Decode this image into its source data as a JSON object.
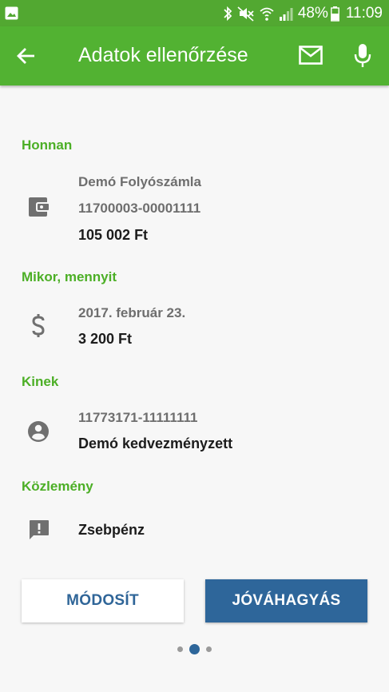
{
  "status_bar": {
    "battery_percent": "48%",
    "time": "11:09",
    "icons": [
      "gallery-icon",
      "bluetooth-icon",
      "mute-icon",
      "wifi-icon",
      "signal-icon",
      "battery-icon"
    ]
  },
  "app_bar": {
    "title": "Adatok ellenőrzése",
    "icons": [
      "back-arrow-icon",
      "mail-icon",
      "mic-icon"
    ]
  },
  "sections": {
    "from": {
      "title": "Honnan",
      "icon": "wallet-icon",
      "account_name": "Demó Folyószámla",
      "account_number": "11700003-00001111",
      "balance": "105 002 Ft"
    },
    "when": {
      "title": "Mikor, mennyit",
      "icon": "dollar-icon",
      "date": "2017. február 23.",
      "amount": "3 200 Ft"
    },
    "to": {
      "title": "Kinek",
      "icon": "account-circle-icon",
      "account_number": "11773171-11111111",
      "name": "Demó kedvezményzett"
    },
    "note": {
      "title": "Közlemény",
      "icon": "feedback-icon",
      "text": "Zsebpénz"
    }
  },
  "buttons": {
    "modify": "MÓDOSÍT",
    "approve": "JÓVÁHAGYÁS"
  },
  "pager": {
    "total": 3,
    "active": 2
  },
  "colors": {
    "status_bar": "#52a831",
    "app_bar": "#52b232",
    "section_title": "#4caf26",
    "primary_blue": "#2e669a",
    "background": "#f7f7f7"
  }
}
